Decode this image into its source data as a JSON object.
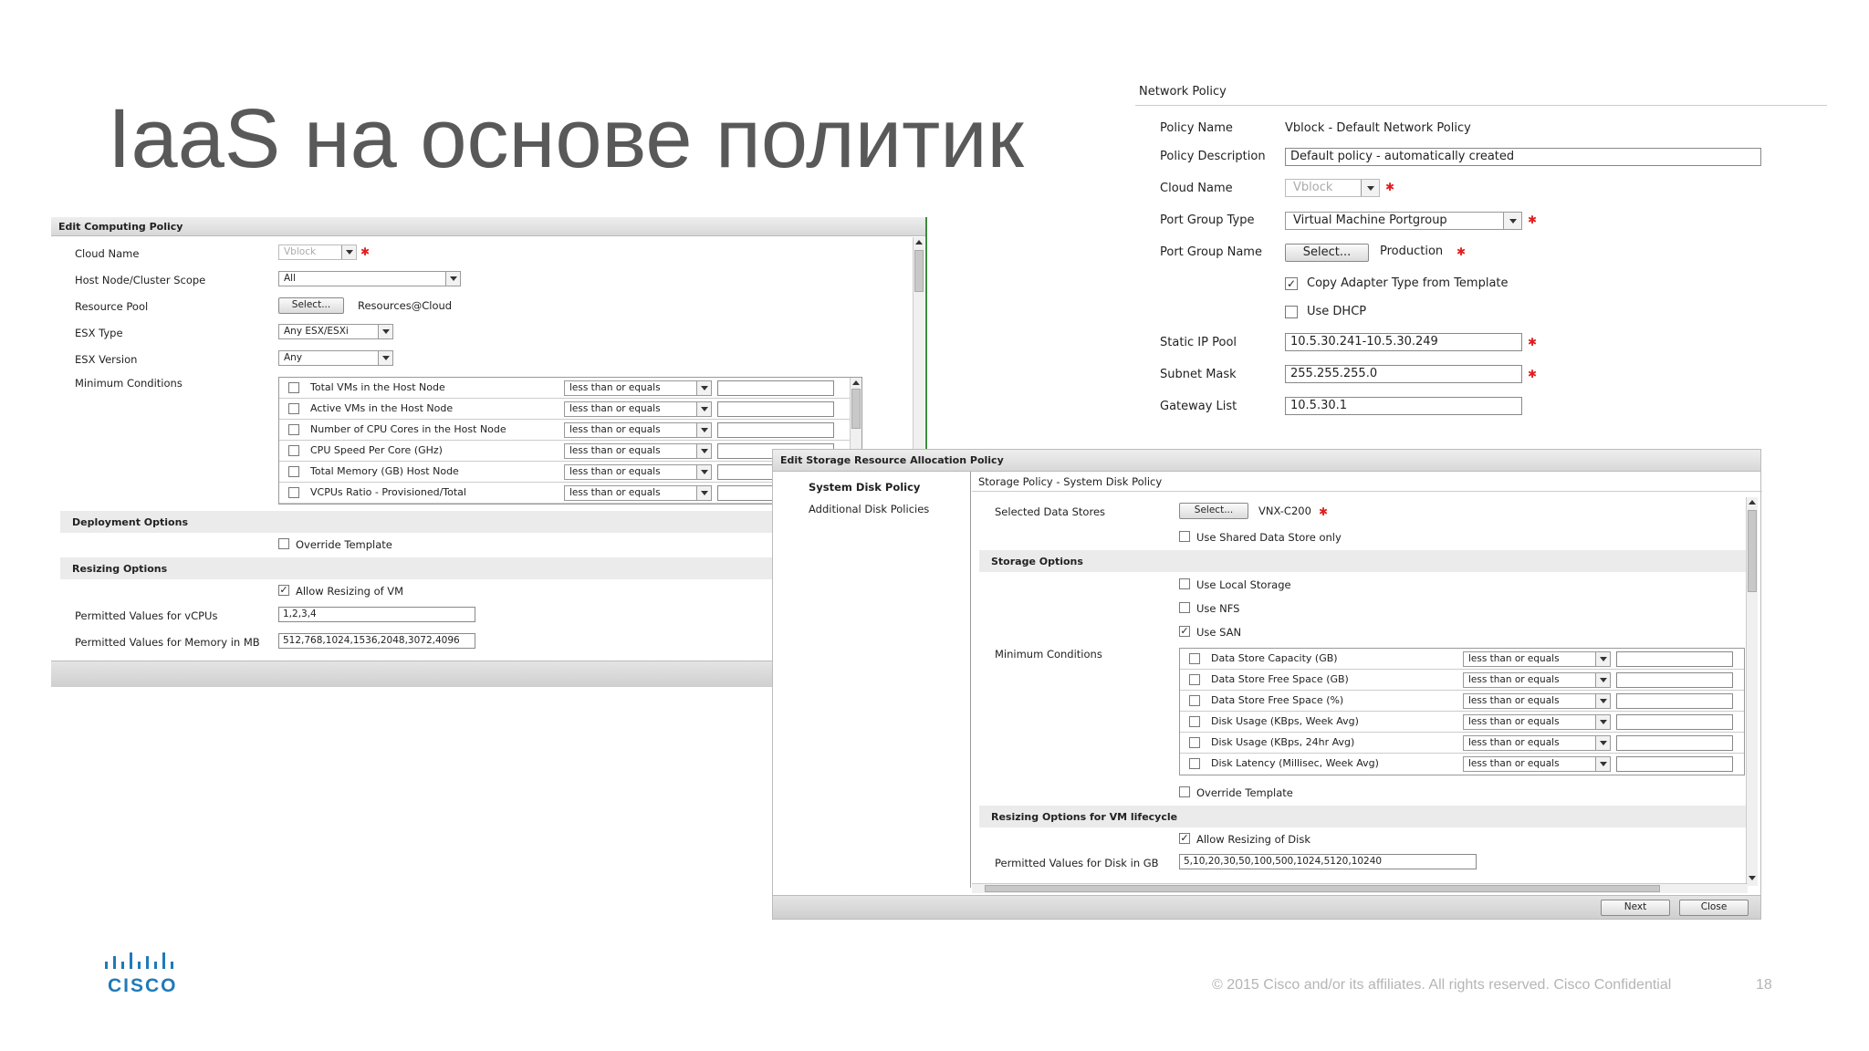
{
  "slide": {
    "title": "IaaS на основе политик",
    "footer_copyright": "© 2015  Cisco and/or its affiliates. All rights reserved.   Cisco Confidential",
    "page_number": "18",
    "logo_text": "CISCO"
  },
  "computing_policy": {
    "header": "Edit Computing Policy",
    "cloud_name_label": "Cloud Name",
    "cloud_name_value": "Vblock",
    "host_scope_label": "Host Node/Cluster Scope",
    "host_scope_value": "All",
    "resource_pool_label": "Resource Pool",
    "select_button": "Select...",
    "resource_pool_value": "Resources@Cloud",
    "esx_type_label": "ESX Type",
    "esx_type_value": "Any ESX/ESXi",
    "esx_version_label": "ESX Version",
    "esx_version_value": "Any",
    "min_conditions_label": "Minimum Conditions",
    "conditions": [
      {
        "label": "Total VMs in the Host Node",
        "operator": "less than or equals"
      },
      {
        "label": "Active VMs in the Host Node",
        "operator": "less than or equals"
      },
      {
        "label": "Number of CPU Cores in the Host Node",
        "operator": "less than or equals"
      },
      {
        "label": "CPU Speed Per Core (GHz)",
        "operator": "less than or equals"
      },
      {
        "label": "Total Memory (GB) Host Node",
        "operator": "less than or equals"
      },
      {
        "label": "VCPUs Ratio - Provisioned/Total",
        "operator": "less than or equals"
      }
    ],
    "deployment_options": "Deployment Options",
    "override_template": "Override Template",
    "resizing_options": "Resizing Options",
    "allow_resizing": "Allow Resizing of VM",
    "vcpus_label": "Permitted Values for vCPUs",
    "vcpus_value": "1,2,3,4",
    "memory_label": "Permitted Values for Memory in MB",
    "memory_value": "512,768,1024,1536,2048,3072,4096"
  },
  "network_policy": {
    "header": "Network Policy",
    "policy_name_label": "Policy Name",
    "policy_name_value": "Vblock - Default Network Policy",
    "policy_desc_label": "Policy Description",
    "policy_desc_value": "Default policy - automatically created",
    "cloud_name_label": "Cloud Name",
    "cloud_name_value": "Vblock",
    "port_group_type_label": "Port Group Type",
    "port_group_type_value": "Virtual Machine Portgroup",
    "port_group_name_label": "Port Group Name",
    "select_button": "Select...",
    "port_group_name_value": "Production",
    "copy_adapter": "Copy Adapter Type from Template",
    "use_dhcp": "Use DHCP",
    "static_ip_label": "Static IP Pool",
    "static_ip_value": "10.5.30.241-10.5.30.249",
    "subnet_label": "Subnet Mask",
    "subnet_value": "255.255.255.0",
    "gateway_label": "Gateway List",
    "gateway_value": "10.5.30.1"
  },
  "storage_policy": {
    "header": "Edit Storage Resource Allocation Policy",
    "nav": [
      "System Disk Policy",
      "Additional Disk Policies"
    ],
    "breadcrumb": "Storage Policy - System Disk Policy",
    "data_stores_label": "Selected Data Stores",
    "select_button": "Select...",
    "data_stores_value": "VNX-C200",
    "shared_only": "Use Shared Data Store only",
    "storage_options": "Storage Options",
    "use_local": "Use Local Storage",
    "use_nfs": "Use NFS",
    "use_san": "Use SAN",
    "min_conditions_label": "Minimum Conditions",
    "conditions": [
      {
        "label": "Data Store Capacity (GB)",
        "operator": "less than or equals"
      },
      {
        "label": "Data Store Free Space (GB)",
        "operator": "less than or equals"
      },
      {
        "label": "Data Store Free Space (%)",
        "operator": "less than or equals"
      },
      {
        "label": "Disk Usage (KBps, Week Avg)",
        "operator": "less than or equals"
      },
      {
        "label": "Disk Usage (KBps, 24hr Avg)",
        "operator": "less than or equals"
      },
      {
        "label": "Disk Latency (Millisec, Week Avg)",
        "operator": "less than or equals"
      }
    ],
    "override_template": "Override Template",
    "resizing_options": "Resizing Options for VM lifecycle",
    "allow_resizing": "Allow Resizing of Disk",
    "disk_values_label": "Permitted Values for Disk in GB",
    "disk_values_value": "5,10,20,30,50,100,500,1024,5120,10240",
    "next_button": "Next",
    "close_button": "Close"
  }
}
